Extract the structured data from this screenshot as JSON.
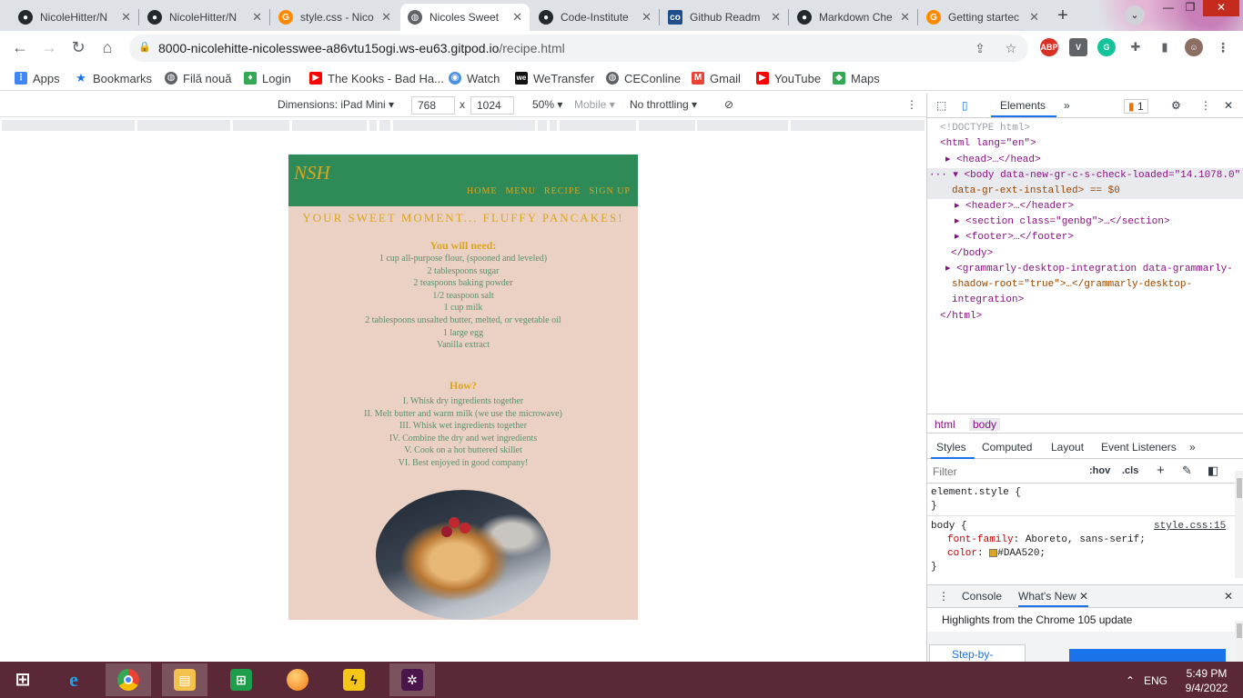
{
  "browser": {
    "tabs": [
      {
        "title": "NicoleHitter/N",
        "icon": "github-icon",
        "active": false
      },
      {
        "title": "NicoleHitter/N",
        "icon": "github-icon",
        "active": false
      },
      {
        "title": "style.css - Nico",
        "icon": "gitpod-icon",
        "active": false
      },
      {
        "title": "Nicoles Sweet",
        "icon": "globe-icon",
        "active": true
      },
      {
        "title": "Code-Institute",
        "icon": "github-icon",
        "active": false
      },
      {
        "title": "Github Readm",
        "icon": "co-icon",
        "active": false
      },
      {
        "title": "Markdown Che",
        "icon": "github-icon",
        "active": false
      },
      {
        "title": "Getting startec",
        "icon": "gitpod-icon",
        "active": false
      }
    ],
    "url_host": "8000-nicolehitte-nicolesswee-a86vtu15ogi.ws-eu63.gitpod.io",
    "url_path": "/recipe.html",
    "extensions": [
      "ABP",
      "V",
      "G",
      "puzzle",
      "panel",
      "avatar"
    ],
    "bookmarks": [
      {
        "label": "Apps",
        "icon": "apps-icon",
        "color": "#4285f4"
      },
      {
        "label": "Bookmarks",
        "icon": "star-icon",
        "color": "#1a73e8"
      },
      {
        "label": "Filă nouă",
        "icon": "globe-icon",
        "color": "#5f6368"
      },
      {
        "label": "Login",
        "icon": "map-pin-icon",
        "color": "#34a853"
      },
      {
        "label": "The Kooks - Bad Ha...",
        "icon": "youtube-icon",
        "color": "#ff0000"
      },
      {
        "label": "Watch",
        "icon": "watch-icon",
        "color": "#4a90e2"
      },
      {
        "label": "WeTransfer",
        "icon": "wetransfer-icon",
        "color": "#111111"
      },
      {
        "label": "CEConline",
        "icon": "globe-icon",
        "color": "#5f6368"
      },
      {
        "label": "Gmail",
        "icon": "gmail-icon",
        "color": "#ea4335"
      },
      {
        "label": "YouTube",
        "icon": "youtube-icon",
        "color": "#ff0000"
      },
      {
        "label": "Maps",
        "icon": "maps-icon",
        "color": "#34a853"
      }
    ]
  },
  "device_toolbar": {
    "dimensions_label": "Dimensions: iPad Mini",
    "width": "768",
    "times": "x",
    "height": "1024",
    "zoom": "50%",
    "mobile": "Mobile",
    "throttling": "No throttling"
  },
  "site": {
    "logo": "NSH",
    "nav": [
      "HOME",
      "MENU",
      "RECIPE",
      "SIGN UP"
    ],
    "title": "YOUR SWEET MOMENT... FLUFFY PANCAKES!",
    "need_heading": "You will need:",
    "ingredients": [
      "1 cup all-purpose flour, (spooned and leveled)",
      "2 tablespoons sugar",
      "2 teaspoons baking powder",
      "1/2 teaspoon salt",
      "1 cup milk",
      "2 tablespoons unsalted butter, melted, or vegetable oil",
      "1 large egg",
      "Vanilla extract"
    ],
    "how_heading": "How?",
    "steps": [
      "I. Whisk dry ingredients together",
      "II. Melt butter and warm milk (we use the microwave)",
      "III. Whisk wet ingredients together",
      "IV. Combine the dry and wet ingredients",
      "V. Cook on a hot buttered skillet",
      "VI. Best enjoyed in good company!"
    ],
    "colors": {
      "header": "#2e8b57",
      "gold": "#daa520",
      "bg": "#ebd1c4",
      "text": "#5b8f6e"
    }
  },
  "devtools": {
    "tab_elements": "Elements",
    "issues_count": "1",
    "dom": {
      "doctype": "<!DOCTYPE html>",
      "html_open": "<html lang=\"en\">",
      "head": "<head>…</head>",
      "body_open_1": "<body data-new-gr-c-s-check-loaded=\"14.1078.0\"",
      "body_open_2": "data-gr-ext-installed> == $0",
      "header": "<header>…</header>",
      "section": "<section class=\"genbg\">…</section>",
      "footer": "<footer>…</footer>",
      "body_close": "</body>",
      "grammarly_1": "<grammarly-desktop-integration data-grammarly-",
      "grammarly_2": "shadow-root=\"true\">…</grammarly-desktop-",
      "grammarly_3": "integration>",
      "html_close": "</html>"
    },
    "crumbs": [
      "html",
      "body"
    ],
    "styles_tabs": [
      "Styles",
      "Computed",
      "Layout",
      "Event Listeners"
    ],
    "filter_placeholder": "Filter",
    "hov": ":hov",
    "cls": ".cls",
    "rules": {
      "element_style": "element.style {",
      "close": "}",
      "body_selector": "body {",
      "source": "style.css:15",
      "font_family_prop": "font-family",
      "font_family_val": "Aboreto, sans-serif;",
      "color_prop": "color",
      "color_val": "#DAA520;"
    },
    "drawer_tabs": [
      "Console",
      "What's New"
    ],
    "whats_new": "Highlights from the Chrome 105 update",
    "step_by": "Step-by-"
  },
  "taskbar": {
    "lang": "ENG",
    "time": "5:49 PM",
    "date": "9/4/2022"
  }
}
